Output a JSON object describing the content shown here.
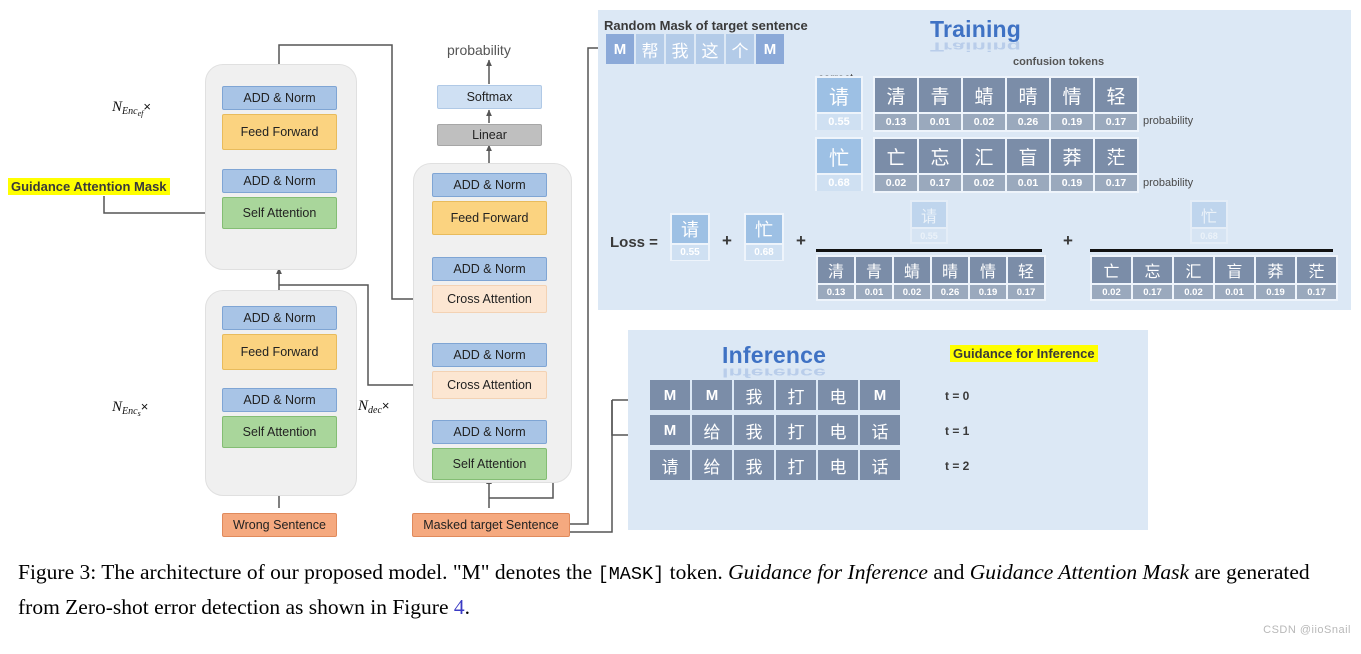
{
  "figure": {
    "caption_prefix": "Figure 3: The architecture of our proposed model. \"M\" denotes the ",
    "caption_mask": "[MASK]",
    "caption_mid": " token. ",
    "caption_em1": "Guidance for Inference",
    "caption_and": " and ",
    "caption_em2": "Guidance Attention Mask",
    "caption_tail": " are generated from Zero-shot error detection as shown in Figure ",
    "caption_ref": "4",
    "caption_end": ".",
    "watermark": "CSDN @iioSnail"
  },
  "architecture": {
    "output_label": "probability",
    "softmax": "Softmax",
    "linear": "Linear",
    "add_norm": "ADD & Norm",
    "feed_forward": "Feed Forward",
    "self_attention": "Self Attention",
    "cross_attention": "Cross Attention",
    "wrong_sentence": "Wrong Sentence",
    "masked_target_sentence": "Masked target Sentence",
    "guidance_attention_mask": "Guidance Attention Mask",
    "enc_ef_repeat": "N",
    "enc_ef_sub": "Enc",
    "enc_ef_sub2": "ef",
    "enc_s_sub2": "s",
    "dec_sub": "dec",
    "times": "×"
  },
  "training": {
    "title": "Training",
    "mask_header": "Random Mask of target sentence",
    "mask_row": [
      "M",
      "帮",
      "我",
      "这",
      "个",
      "M"
    ],
    "mask_row_kinds": [
      "m",
      "cn",
      "cn",
      "cn",
      "cn",
      "m"
    ],
    "correct_token_label": "correct\ntoken",
    "correct_token_label_line1": "correct",
    "correct_token_label_line2": "token",
    "confusion_label": "confusion tokens",
    "probability_label": "probability",
    "correct_tokens": [
      {
        "char": "请",
        "prob": "0.55"
      },
      {
        "char": "忙",
        "prob": "0.68"
      }
    ],
    "confusion_rows": [
      {
        "chars": [
          "清",
          "青",
          "蜻",
          "晴",
          "情",
          "轻"
        ],
        "probs": [
          "0.13",
          "0.01",
          "0.02",
          "0.26",
          "0.19",
          "0.17"
        ]
      },
      {
        "chars": [
          "亡",
          "忘",
          "汇",
          "盲",
          "莽",
          "茫"
        ],
        "probs": [
          "0.02",
          "0.17",
          "0.02",
          "0.01",
          "0.19",
          "0.17"
        ]
      }
    ],
    "loss_label": "Loss =",
    "plus": "+"
  },
  "inference": {
    "title": "Inference",
    "guidance_label": "Guidance for Inference",
    "rows": [
      {
        "tokens": [
          "M",
          "M",
          "我",
          "打",
          "电",
          "M"
        ],
        "kinds": [
          "m",
          "m",
          "cn",
          "cn",
          "cn",
          "m"
        ],
        "step": "t = 0"
      },
      {
        "tokens": [
          "M",
          "给",
          "我",
          "打",
          "电",
          "话"
        ],
        "kinds": [
          "m",
          "cn",
          "cn",
          "cn",
          "cn",
          "cn"
        ],
        "step": "t = 1"
      },
      {
        "tokens": [
          "请",
          "给",
          "我",
          "打",
          "电",
          "话"
        ],
        "kinds": [
          "cn",
          "cn",
          "cn",
          "cn",
          "cn",
          "cn"
        ],
        "step": "t = 2"
      }
    ]
  },
  "colors": {
    "add_norm": "#a8c4e6",
    "feed_forward": "#fbd380",
    "self_attention": "#a9d69b",
    "cross_attention": "#fce6d2",
    "softmax": "#cfe0f3",
    "linear": "#bfbfbf",
    "sentence_box": "#f5a97f",
    "panel_bg": "#dce8f5",
    "highlight": "#ffff00",
    "title_blue": "#3f72c4",
    "token_blue": "#8ba9d8",
    "token_grey": "#7b8da8"
  }
}
